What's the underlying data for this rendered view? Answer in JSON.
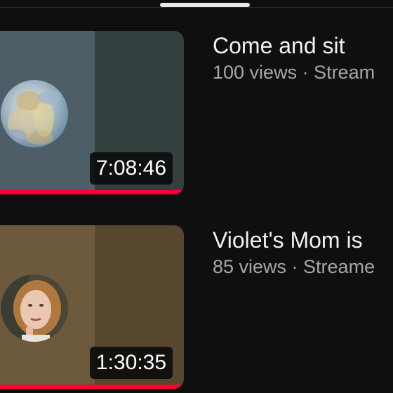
{
  "videos": [
    {
      "title": "Come and sit",
      "subtitle": "100 views · Stream",
      "duration": "7:08:46",
      "watch_progress": 1.0,
      "colors": {
        "thumb_left": "#4d5e66",
        "thumb_right": "#33403f"
      },
      "avatar_icon": "blurred-portrait"
    },
    {
      "title": "Violet's Mom is",
      "subtitle": "85 views · Streame",
      "duration": "1:30:35",
      "watch_progress": 1.0,
      "colors": {
        "thumb_left": "#6d5a3c",
        "thumb_right": "#57472f"
      },
      "avatar_icon": "woman-portrait"
    }
  ],
  "theme": {
    "background": "#0f0f0f",
    "progress_color": "#ff0033"
  }
}
